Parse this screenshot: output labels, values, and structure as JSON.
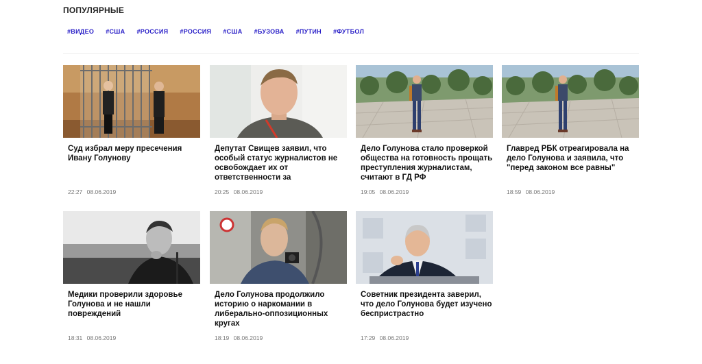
{
  "section": {
    "title": "ПОПУЛЯРНЫЕ",
    "tags": [
      "#ВИДЕО",
      "#США",
      "#РОССИЯ",
      "#РОССИЯ",
      "#США",
      "#БУЗОВА",
      "#ПУТИН",
      "#ФУТБОЛ"
    ]
  },
  "articles": [
    {
      "headline": "Суд избрал меру пресечения Ивану Голунову",
      "time": "22:27",
      "date": "08.06.2019",
      "image": "court-cage-photo"
    },
    {
      "headline": "Депутат Свищев заявил, что особый статус журналистов не освобождает их от ответственности за",
      "time": "20:25",
      "date": "08.06.2019",
      "image": "portrait-photo"
    },
    {
      "headline": "Дело Голунова стало проверкой общества на готовность прощать преступления журналистам, считают в ГД РФ",
      "time": "19:05",
      "date": "08.06.2019",
      "image": "park-walk-photo"
    },
    {
      "headline": "Главред РБК отреагировала на дело Голунова и заявила, что \"перед законом все равны\"",
      "time": "18:59",
      "date": "08.06.2019",
      "image": "park-walk-photo"
    },
    {
      "headline": "Медики проверили здоровье Голунова и не нашли повреждений",
      "time": "18:31",
      "date": "08.06.2019",
      "image": "bw-seaside-photo"
    },
    {
      "headline": "Дело Голунова продолжило историю о наркомании в либерально-оппозиционных кругах",
      "time": "18:19",
      "date": "08.06.2019",
      "image": "mirror-selfie-photo"
    },
    {
      "headline": "Советник президента заверил, что дело Голунова будет изучено беспристрастно",
      "time": "17:29",
      "date": "08.06.2019",
      "image": "speaker-podium-photo"
    }
  ]
}
